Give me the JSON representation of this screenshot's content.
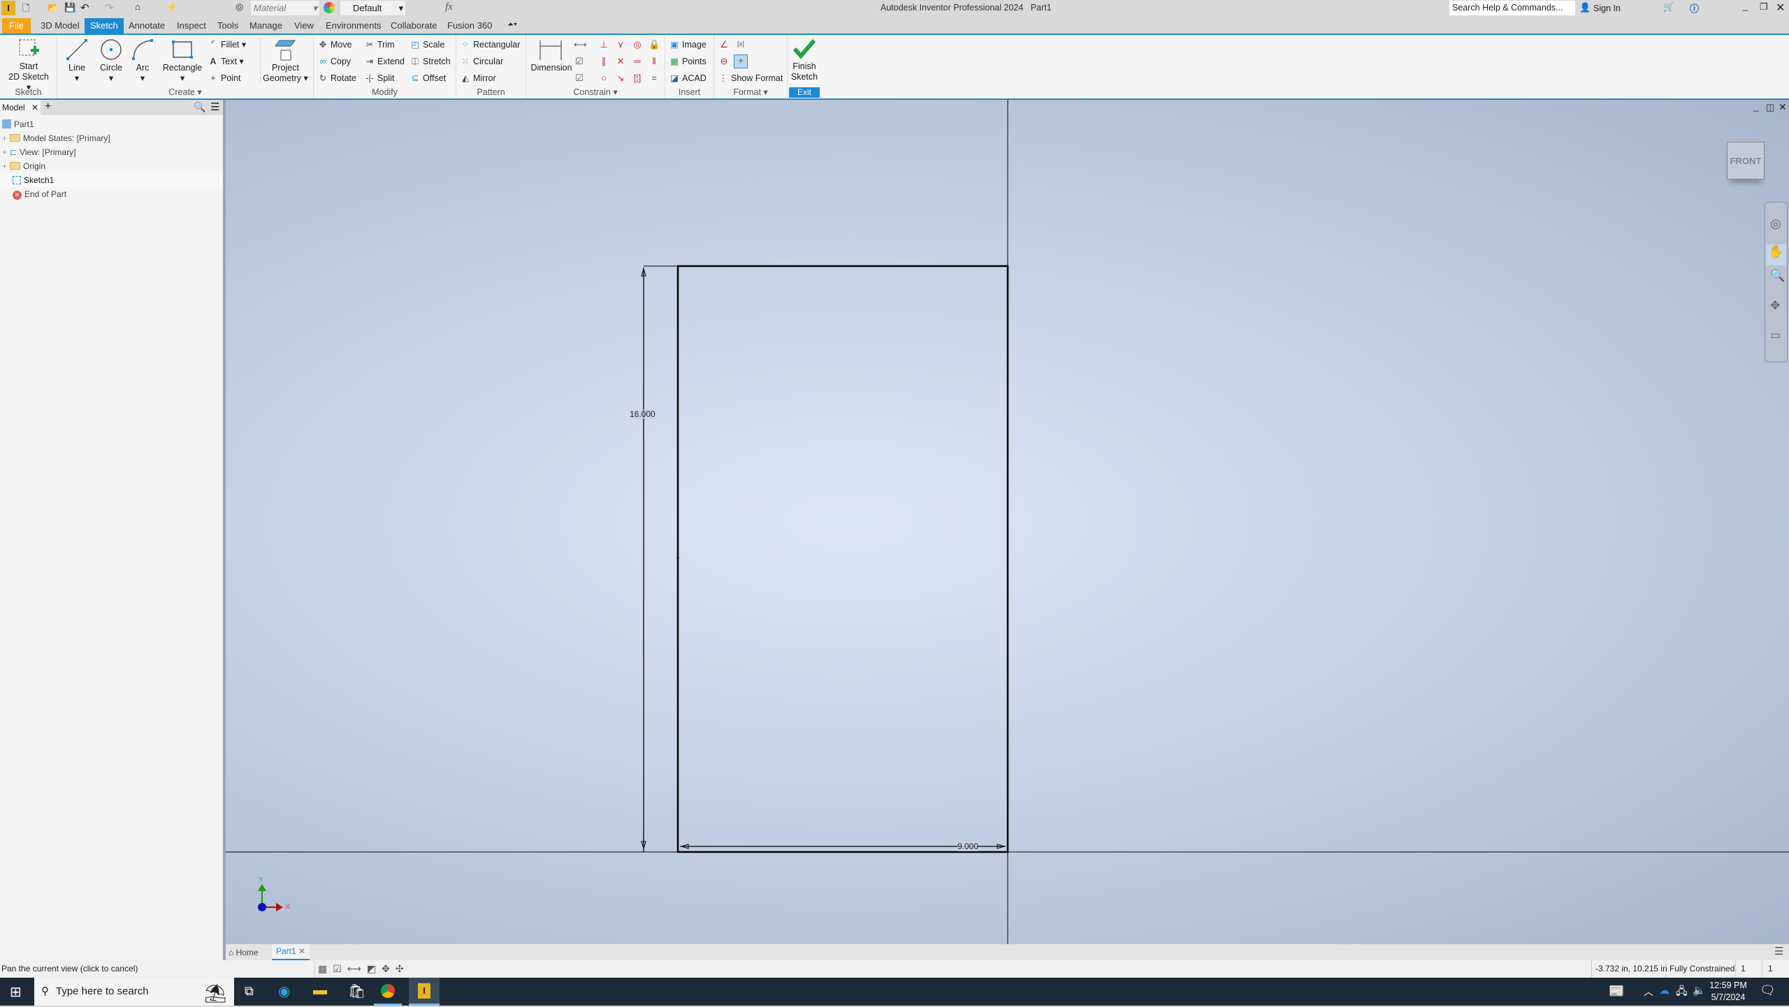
{
  "app": {
    "title": "Autodesk Inventor Professional 2024",
    "document": "Part1",
    "logo_letter": "I"
  },
  "qat": {
    "material": "Material",
    "appearance": "Default",
    "fx": "fx"
  },
  "help": {
    "search_placeholder": "Search Help & Commands...",
    "sign_in": "Sign In"
  },
  "tabs": [
    "File",
    "3D Model",
    "Sketch",
    "Annotate",
    "Inspect",
    "Tools",
    "Manage",
    "View",
    "Environments",
    "Collaborate",
    "Fusion 360"
  ],
  "active_tab": "Sketch",
  "ribbon": {
    "sketch": {
      "label": "Sketch",
      "start": "Start",
      "start2": "2D Sketch"
    },
    "create": {
      "label": "Create",
      "line": "Line",
      "circle": "Circle",
      "arc": "Arc",
      "rectangle": "Rectangle",
      "fillet": "Fillet",
      "text": "Text",
      "point": "Point",
      "project1": "Project",
      "project2": "Geometry"
    },
    "modify": {
      "label": "Modify",
      "move": "Move",
      "copy": "Copy",
      "rotate": "Rotate",
      "trim": "Trim",
      "extend": "Extend",
      "split": "Split",
      "scale": "Scale",
      "stretch": "Stretch",
      "offset": "Offset"
    },
    "pattern": {
      "label": "Pattern",
      "rectangular": "Rectangular",
      "circular": "Circular",
      "mirror": "Mirror"
    },
    "constrain": {
      "label": "Constrain",
      "dimension": "Dimension"
    },
    "insert": {
      "label": "Insert",
      "image": "Image",
      "points": "Points",
      "acad": "ACAD"
    },
    "format": {
      "label": "Format",
      "show_format": "Show Format"
    },
    "exit": {
      "label": "Exit",
      "finish1": "Finish",
      "finish2": "Sketch"
    }
  },
  "browser": {
    "tab": "Model",
    "items": [
      {
        "label": "Part1",
        "icon": "part-icon"
      },
      {
        "label": "Model States: [Primary]",
        "icon": "folder-icon"
      },
      {
        "label": "View: [Primary]",
        "icon": "view-icon"
      },
      {
        "label": "Origin",
        "icon": "folder-icon"
      },
      {
        "label": "Sketch1",
        "icon": "sketch-icon"
      },
      {
        "label": "End of Part",
        "icon": "end-of-part-icon"
      }
    ]
  },
  "viewport": {
    "viewcube": "FRONT",
    "dim_height": "16.000",
    "dim_width": "9.000",
    "axis_x": "X",
    "axis_y": "Y"
  },
  "doc_tabs": {
    "home": "Home",
    "part": "Part1"
  },
  "status": {
    "message": "Pan the current view (click to cancel)",
    "coords": "-3.732 in, 10.215 in",
    "constraint": "Fully Constrained",
    "count1": "1",
    "count2": "1"
  },
  "taskbar": {
    "search_placeholder": "Type here to search",
    "time": "12:59 PM",
    "date": "5/7/2024"
  },
  "colors": {
    "accent": "#1b8ad3",
    "file_tab": "#f5a31a",
    "finish_check": "#22a34a"
  }
}
